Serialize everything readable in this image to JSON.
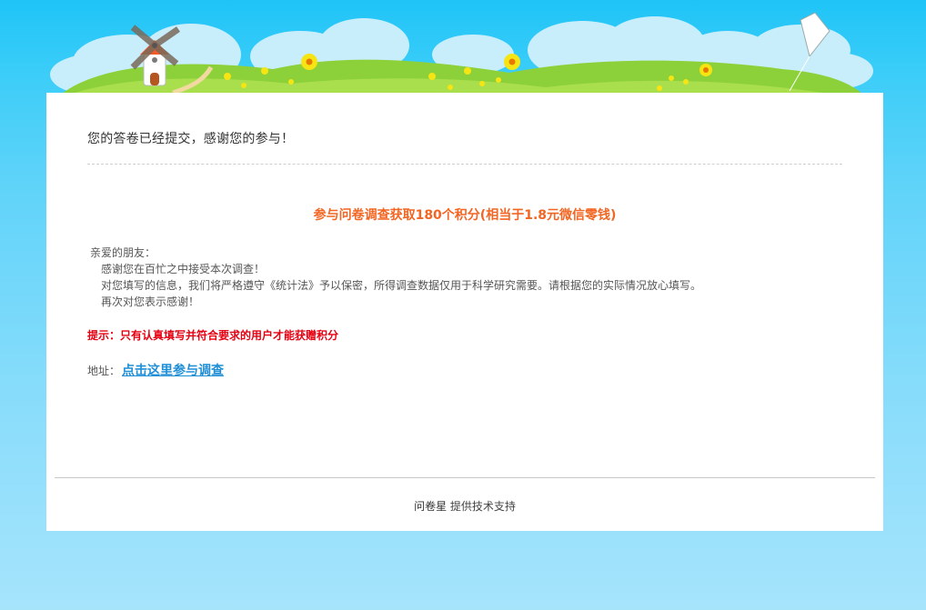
{
  "header": {
    "colors": {
      "sky": "#1fc4f7",
      "grass": "#8dd13a",
      "card": "#ffffff"
    },
    "icons": [
      "windmill-icon",
      "kite-icon",
      "flower-icon"
    ]
  },
  "confirmation": {
    "message": "您的答卷已经提交，感谢您的参与！"
  },
  "reward": {
    "text": "参与问卷调查获取180个积分(相当于1.8元微信零钱)",
    "color": "#f26522"
  },
  "letter": {
    "greeting": "亲爱的朋友：",
    "line1": "感谢您在百忙之中接受本次调查！",
    "line2": "对您填写的信息，我们将严格遵守《统计法》予以保密，所得调查数据仅用于科学研究需要。请根据您的实际情况放心填写。",
    "line3": "再次对您表示感谢！"
  },
  "tip": {
    "text": "提示：只有认真填写并符合要求的用户才能获赠积分",
    "color": "#e60012"
  },
  "address": {
    "label": "地址：",
    "link_text": "点击这里参与调查",
    "link_color": "#1e8fd6"
  },
  "footer": {
    "brand": "问卷星",
    "text": "提供技术支持"
  }
}
